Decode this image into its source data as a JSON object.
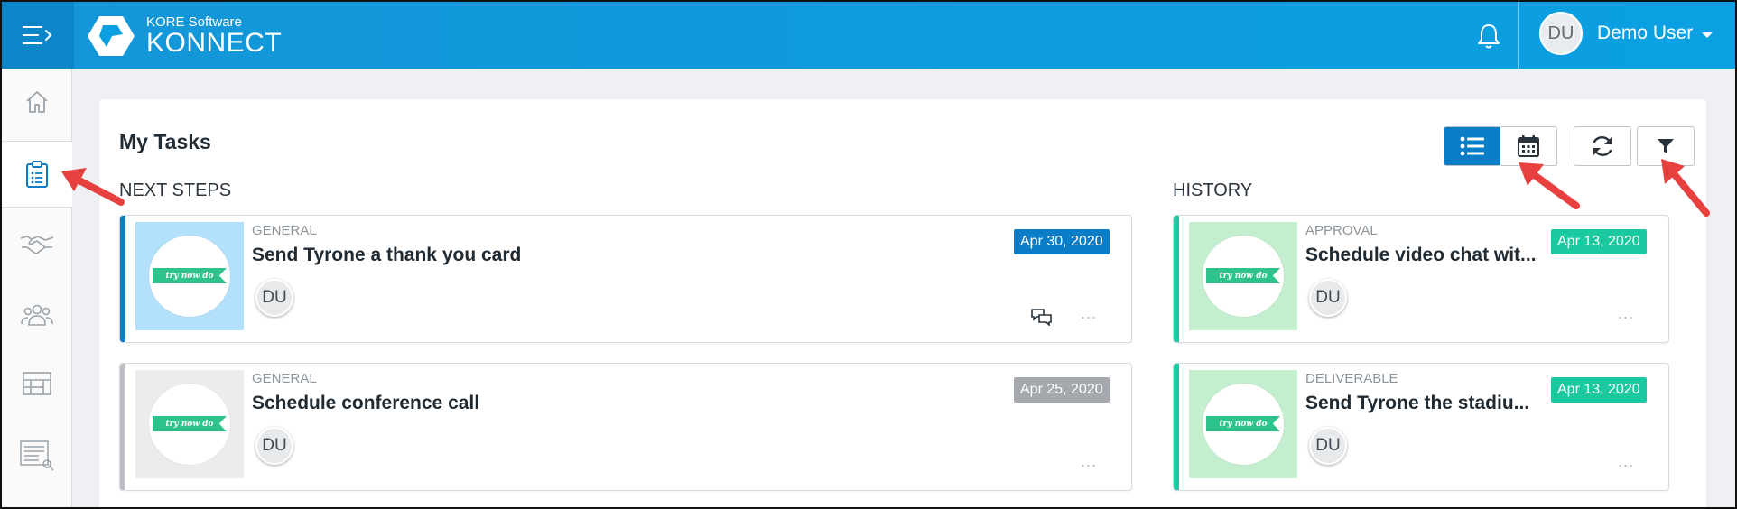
{
  "header": {
    "logo_sub": "KORE Software",
    "logo_main": "KONNECT",
    "user_initials": "DU",
    "user_name": "Demo User"
  },
  "sidebar": {
    "items": [
      {
        "icon": "home-icon"
      },
      {
        "icon": "clipboard-task-icon",
        "active": true
      },
      {
        "icon": "handshake-icon"
      },
      {
        "icon": "people-group-icon"
      },
      {
        "icon": "stadium-icon"
      },
      {
        "icon": "report-search-icon"
      }
    ]
  },
  "main": {
    "title": "My Tasks",
    "next_steps_label": "NEXT STEPS",
    "history_label": "HISTORY",
    "thumb_text": "try now do",
    "next_steps": [
      {
        "type": "GENERAL",
        "name": "Send Tyrone a thank you card",
        "assignee": "DU",
        "date": "Apr 30, 2020",
        "date_color": "#0b7dc6",
        "accent": "#0b7dc6",
        "thumb_bg": "#b3e0fb",
        "has_comment": true
      },
      {
        "type": "GENERAL",
        "name": "Schedule conference call",
        "assignee": "DU",
        "date": "Apr 25, 2020",
        "date_color": "#a5a9ad",
        "accent": "#bcc0c4",
        "thumb_bg": "#ececec",
        "has_comment": false
      }
    ],
    "history": [
      {
        "type": "APPROVAL",
        "name": "Schedule video chat wit...",
        "assignee": "DU",
        "date": "Apr 13, 2020",
        "date_color": "#1ac9a0",
        "accent": "#1ac9a0",
        "thumb_bg": "#c4efcf"
      },
      {
        "type": "DELIVERABLE",
        "name": "Send Tyrone the stadiu...",
        "assignee": "DU",
        "date": "Apr 13, 2020",
        "date_color": "#1ac9a0",
        "accent": "#1ac9a0",
        "thumb_bg": "#c4efcf"
      }
    ],
    "more_label": "...",
    "colors": {
      "accent": "#0b7dc6",
      "header": "#0aa0e2",
      "annotation_arrow": "#e8403f"
    }
  }
}
